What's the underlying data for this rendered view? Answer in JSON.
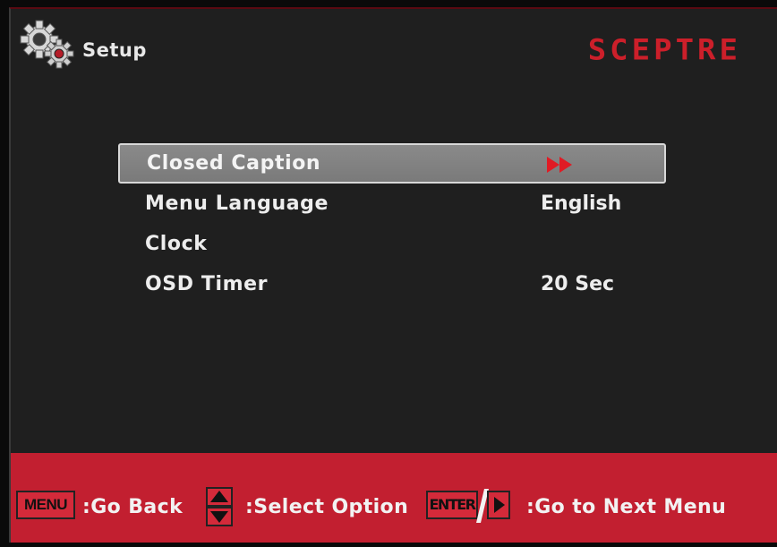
{
  "header": {
    "title": "Setup",
    "brand": "SCEPTRE",
    "icon": "gear-icon"
  },
  "menu": {
    "items": [
      {
        "label": "Closed Caption",
        "value": "",
        "icon": "submenu-arrow-icon",
        "selected": true
      },
      {
        "label": "Menu Language",
        "value": "English"
      },
      {
        "label": "Clock",
        "value": ""
      },
      {
        "label": "OSD Timer",
        "value": "20 Sec"
      }
    ]
  },
  "footer": {
    "menu_key": "MENU",
    "go_back": ":Go Back",
    "select_option": ":Select Option",
    "enter_key": "ENTER",
    "next_menu": ":Go to Next Menu"
  },
  "colors": {
    "brand_red": "#cc1f2a",
    "footer_red": "#c21f30",
    "panel": "#1f1f1f",
    "selection": "#828282"
  }
}
